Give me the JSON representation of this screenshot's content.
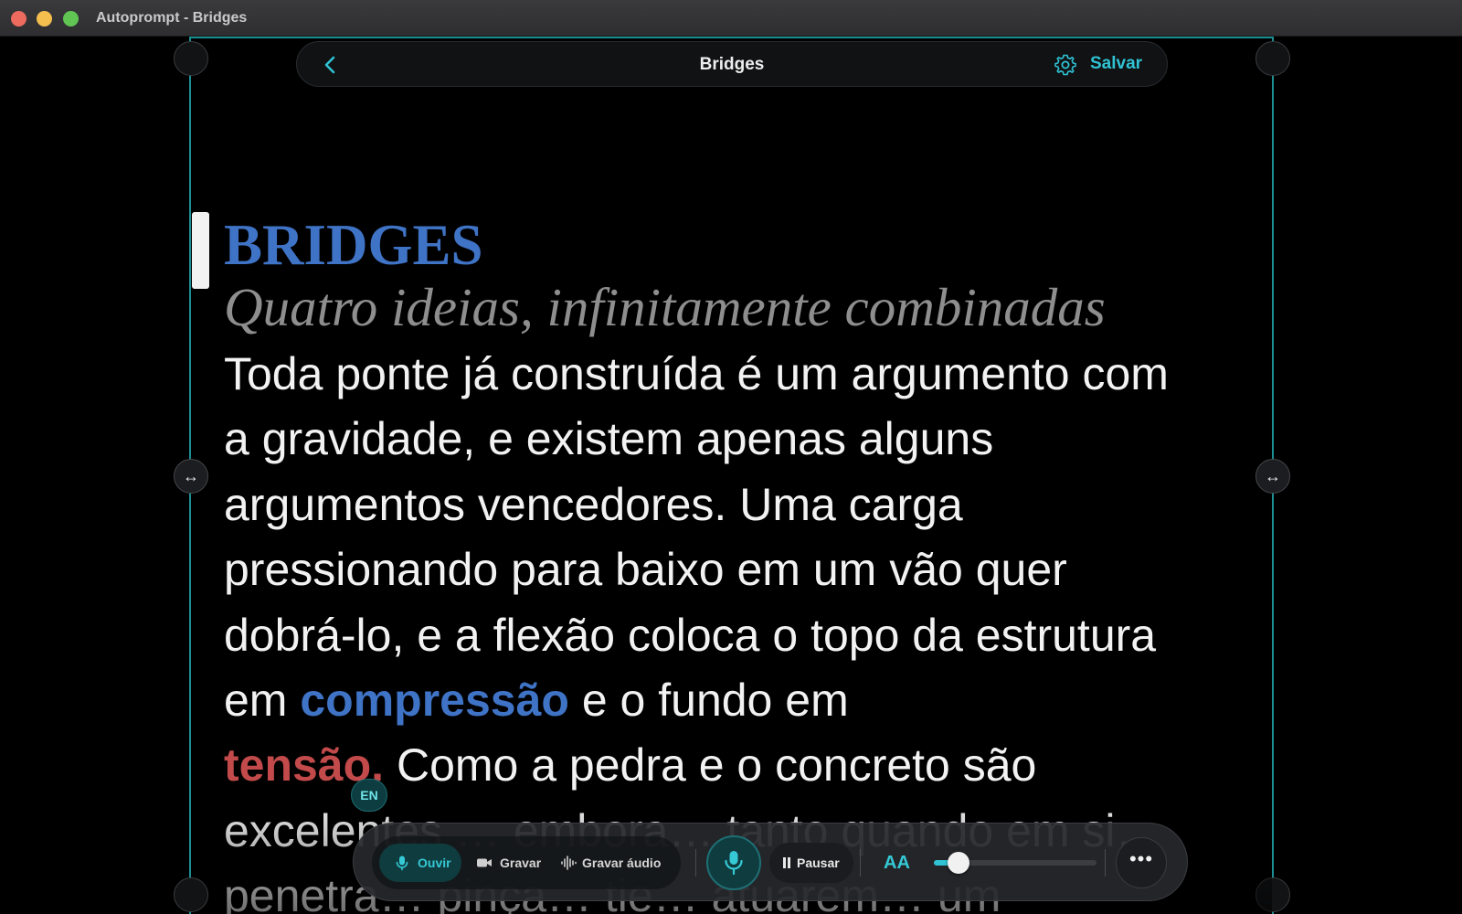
{
  "window": {
    "title": "Autoprompt - Bridges"
  },
  "topbar": {
    "doc_title": "Bridges",
    "save_label": "Salvar"
  },
  "script": {
    "title": "BRIDGES",
    "subtitle": "Quatro ideias, infinitamente combinadas",
    "line1": "Toda ponte já construída é um argumento com",
    "line2": "a gravidade, e existem apenas alguns",
    "line3": "argumentos vencedores. Uma carga",
    "line4": "pressionando para baixo em um vão quer",
    "line5": "dobrá-lo, e a flexão coloca o topo da estrutura",
    "line6_pre": "em ",
    "line6_kw": "compressão",
    "line6_post": " e o fundo em",
    "line7_kw": "tensão.",
    "line7_post": " Como a pedra e o concreto são",
    "line8": "excelentes … embora… tanto quando em si…",
    "line9": "penetra… pinça… tie… atuarem… um"
  },
  "language_badge": "EN",
  "controls": {
    "listen_label": "Ouvir",
    "record_label": "Gravar",
    "record_audio_label": "Gravar áudio",
    "pause_label": "Pausar",
    "text_size_label": "AA",
    "font_size_level": 0.15
  },
  "colors": {
    "accent": "#2fc3d4",
    "heading_blue": "#3f73c6",
    "keyword_red": "#c24a4a",
    "frame": "#1b8e92"
  },
  "icons": [
    "back-chevron-icon",
    "gear-icon",
    "microphone-icon",
    "video-camera-icon",
    "waveform-icon",
    "pause-icon",
    "more-dots-icon",
    "resize-horizontal-icon"
  ]
}
